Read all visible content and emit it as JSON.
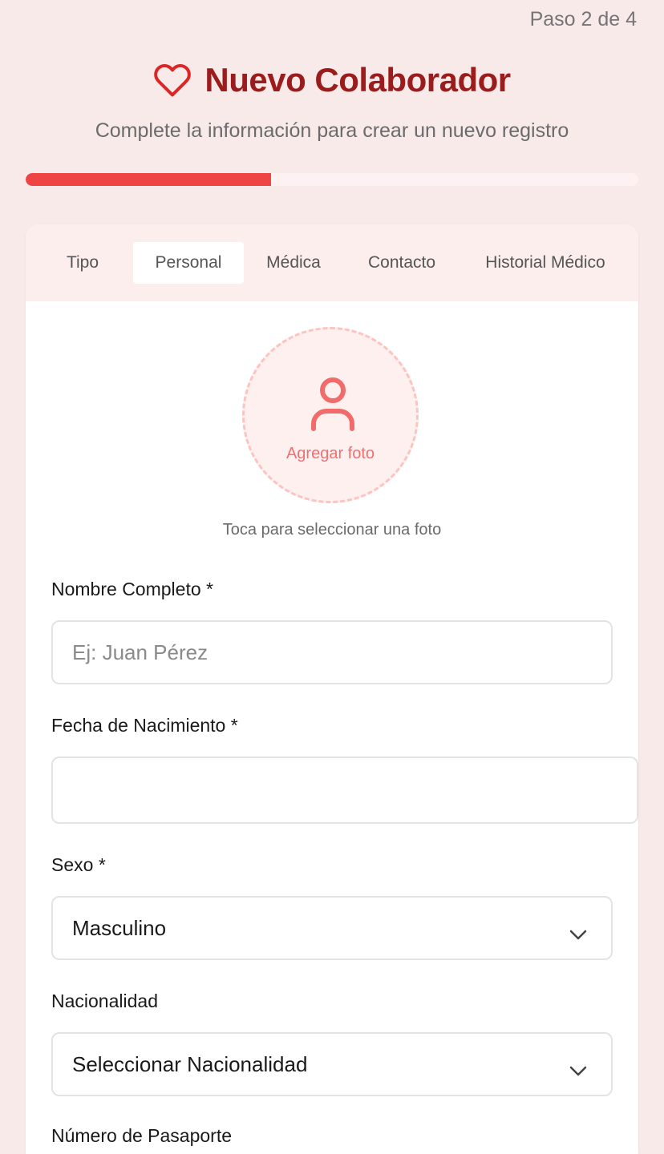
{
  "step_indicator": "Paso 2 de 4",
  "header": {
    "title": "Nuevo Colaborador",
    "subtitle": "Complete la información para crear un nuevo registro",
    "icon": "heart-icon"
  },
  "progress": {
    "fraction": 0.4
  },
  "tabs": [
    {
      "label": "Tipo",
      "active": false
    },
    {
      "label": "Personal",
      "active": true
    },
    {
      "label": "Médica",
      "active": false
    },
    {
      "label": "Contacto",
      "active": false
    },
    {
      "label": "Historial Médico",
      "active": false
    }
  ],
  "photo": {
    "label": "Agregar foto",
    "hint": "Toca para seleccionar una foto",
    "icon": "user-icon"
  },
  "fields": {
    "name": {
      "label": "Nombre Completo *",
      "placeholder": "Ej: Juan Pérez",
      "value": ""
    },
    "birthdate": {
      "label": "Fecha de Nacimiento *",
      "value": ""
    },
    "sex": {
      "label": "Sexo *",
      "selected": "Masculino"
    },
    "nationality": {
      "label": "Nacionalidad",
      "selected": "Seleccionar Nacionalidad"
    },
    "next_field_label": "Número de Pasaporte"
  },
  "colors": {
    "accent": "#ef4444",
    "title": "#9b1c1c",
    "background": "#f9eaea",
    "tab_bar": "#fdeeee",
    "photo_text": "#f07070"
  }
}
